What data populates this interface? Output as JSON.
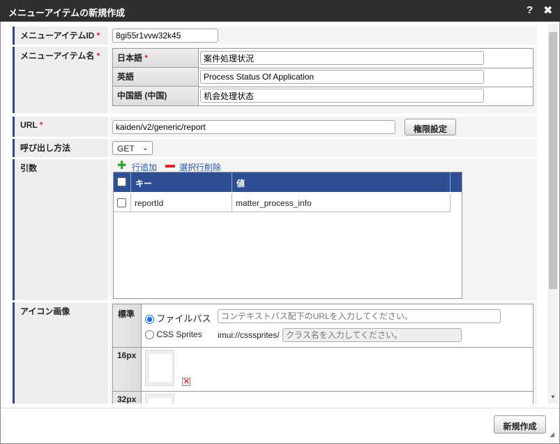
{
  "dialog": {
    "title": "メニューアイテムの新規作成",
    "help": "?",
    "close": "✖"
  },
  "fields": {
    "id": {
      "label": "メニューアイテムID",
      "req": "*",
      "value": "8gi55r1vvw32k45"
    },
    "name": {
      "label": "メニューアイテム名",
      "req": "*",
      "langs": [
        {
          "label": "日本語",
          "req": "*",
          "value": "案件処理状況"
        },
        {
          "label": "英語",
          "value": "Process Status Of Application"
        },
        {
          "label": "中国語 (中国)",
          "value": "机会处理状态"
        }
      ]
    },
    "url": {
      "label": "URL",
      "req": "*",
      "value": "kaiden/v2/generic/report",
      "permission_button": "権限設定"
    },
    "method": {
      "label": "呼び出し方法",
      "value": "GET"
    },
    "args": {
      "label": "引数",
      "add": "行追加",
      "delete": "選択行削除",
      "columns": [
        "キー",
        "値"
      ],
      "rows": [
        {
          "key": "reportId",
          "value": "matter_process_info"
        }
      ]
    },
    "icon": {
      "label": "アイコン画像",
      "standard": "標準",
      "file_path": "ファイルパス",
      "file_placeholder": "コンテキストパス配下のURLを入力してください。",
      "css_sprites": "CSS Sprites",
      "sprite_prefix": "imui://csssprites/",
      "class_placeholder": "クラス名を入力してください。",
      "size16": "16px",
      "size32": "32px"
    }
  },
  "footer": {
    "create": "新規作成"
  }
}
